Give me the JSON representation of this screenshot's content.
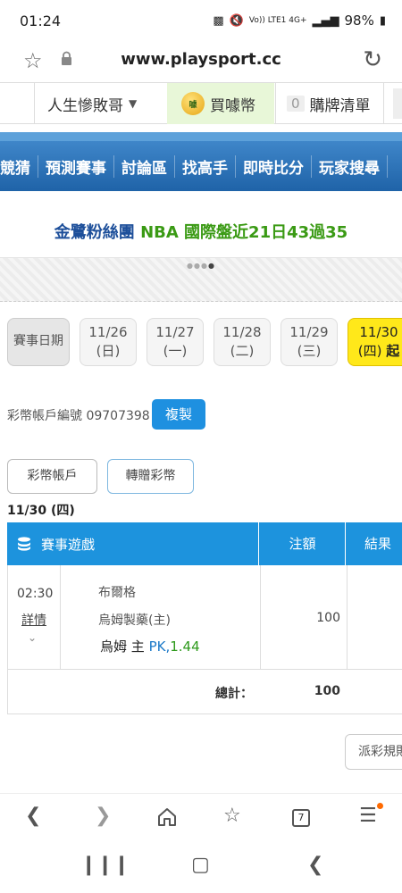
{
  "status": {
    "time": "01:24",
    "network": "Vo)) LTE1 4G+",
    "battery": "98%"
  },
  "browser": {
    "url": "www.playsport.cc"
  },
  "topnav": {
    "user": "人生慘敗哥",
    "buy_coin": "買噱幣",
    "coin_badge": "噱",
    "cart_count": "0",
    "cart_label": "購牌清單"
  },
  "mainnav": {
    "items": [
      "競猜",
      "預測賽事",
      "討論區",
      "找高手",
      "即時比分",
      "玩家搜尋"
    ]
  },
  "banner": {
    "part1": "金鷺粉絲團",
    "part2": "NBA 國際盤近21日43過35"
  },
  "dates": {
    "label": "賽事日期",
    "tabs": [
      {
        "date": "11/26",
        "day": "(日)"
      },
      {
        "date": "11/27",
        "day": "(一)"
      },
      {
        "date": "11/28",
        "day": "(二)"
      },
      {
        "date": "11/29",
        "day": "(三)"
      },
      {
        "date": "11/30",
        "day": "(四)",
        "suffix": "起"
      }
    ]
  },
  "account": {
    "text": "彩幣帳戶編號 09707398",
    "copy": "複製",
    "btn_account": "彩幣帳戶",
    "btn_transfer": "轉贈彩幣"
  },
  "list_date": "11/30 (四)",
  "table": {
    "headers": {
      "game": "賽事遊戲",
      "amount": "注額",
      "result": "結果"
    },
    "row": {
      "time": "02:30",
      "detail": "詳情",
      "team1": "布爾格",
      "team2": "烏姆製藥(主)",
      "pick": "烏姆 主",
      "pk": "PK,",
      "odds": "1.44",
      "amount": "100"
    },
    "total_label": "總計：",
    "total_value": "100"
  },
  "payout_btn": "派彩規則",
  "bottombar": {
    "tab_count": "7"
  }
}
